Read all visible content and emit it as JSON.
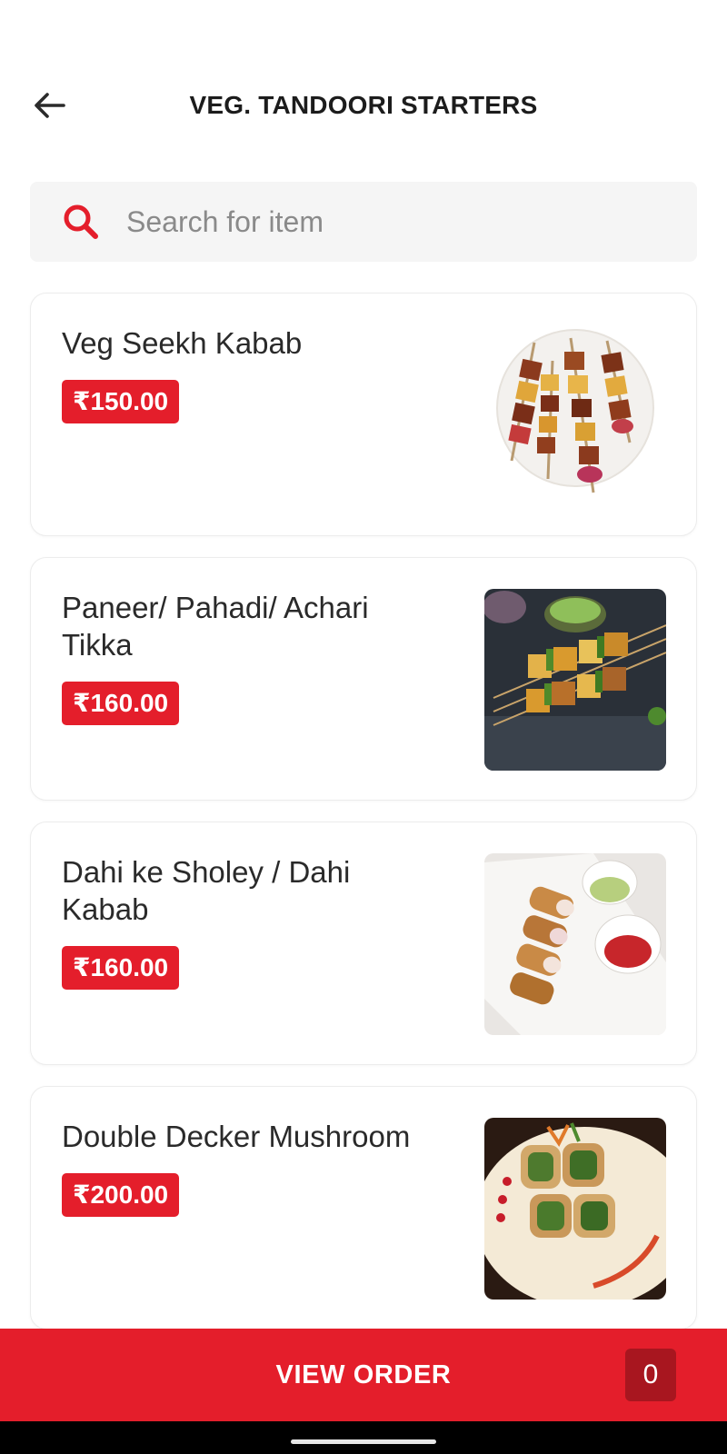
{
  "header": {
    "title": "VEG. TANDOORI STARTERS",
    "back_icon": "arrow-left-icon"
  },
  "search": {
    "icon": "search-icon",
    "placeholder": "Search for item",
    "value": ""
  },
  "items": [
    {
      "name": "Veg Seekh Kabab",
      "price": "₹150.00",
      "image": "veg-seekh-kabab-photo"
    },
    {
      "name": "Paneer/ Pahadi/ Achari Tikka",
      "price": "₹160.00",
      "image": "paneer-tikka-photo"
    },
    {
      "name": "Dahi ke Sholey / Dahi Kabab",
      "price": "₹160.00",
      "image": "dahi-kabab-photo"
    },
    {
      "name": "Double Decker Mushroom",
      "price": "₹200.00",
      "image": "double-decker-mushroom-photo"
    }
  ],
  "order_bar": {
    "label": "VIEW ORDER",
    "count": "0"
  },
  "colors": {
    "accent": "#e41e2b",
    "accent_dark": "#a8161f",
    "search_bg": "#f5f5f5"
  }
}
